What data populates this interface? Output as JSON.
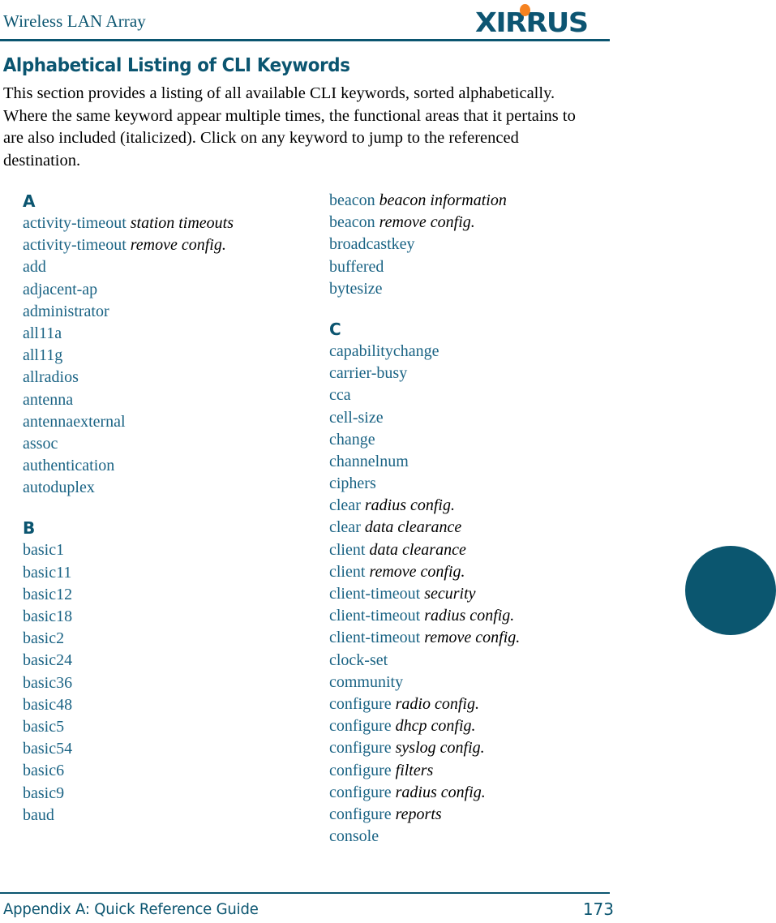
{
  "header": {
    "title": "Wireless LAN Array",
    "logo_text": "XIRRUS",
    "logo_color": "#0d5572",
    "logo_dot_color": "#f58220",
    "rule_color": "#0b5570"
  },
  "section": {
    "heading": "Alphabetical Listing of CLI Keywords",
    "intro": "This section provides a listing of all available CLI keywords, sorted alphabetically. Where the same keyword appear multiple times, the functional areas that it pertains to are also included (italicized). Click on any keyword to jump to the referenced destination."
  },
  "index": {
    "left_column": [
      {
        "type": "letter",
        "label": "A"
      },
      {
        "type": "keyword",
        "keyword": "activity-timeout",
        "area": "station timeouts"
      },
      {
        "type": "keyword",
        "keyword": "activity-timeout",
        "area": "remove config."
      },
      {
        "type": "keyword",
        "keyword": "add",
        "area": ""
      },
      {
        "type": "keyword",
        "keyword": "adjacent-ap",
        "area": ""
      },
      {
        "type": "keyword",
        "keyword": "administrator",
        "area": ""
      },
      {
        "type": "keyword",
        "keyword": "all11a",
        "area": ""
      },
      {
        "type": "keyword",
        "keyword": "all11g",
        "area": ""
      },
      {
        "type": "keyword",
        "keyword": "allradios",
        "area": ""
      },
      {
        "type": "keyword",
        "keyword": "antenna",
        "area": ""
      },
      {
        "type": "keyword",
        "keyword": "antennaexternal",
        "area": ""
      },
      {
        "type": "keyword",
        "keyword": "assoc",
        "area": ""
      },
      {
        "type": "keyword",
        "keyword": "authentication",
        "area": ""
      },
      {
        "type": "keyword",
        "keyword": "autoduplex",
        "area": ""
      },
      {
        "type": "letter",
        "label": "B",
        "spaced": true
      },
      {
        "type": "keyword",
        "keyword": "basic1",
        "area": ""
      },
      {
        "type": "keyword",
        "keyword": "basic11",
        "area": ""
      },
      {
        "type": "keyword",
        "keyword": "basic12",
        "area": ""
      },
      {
        "type": "keyword",
        "keyword": "basic18",
        "area": ""
      },
      {
        "type": "keyword",
        "keyword": "basic2",
        "area": ""
      },
      {
        "type": "keyword",
        "keyword": "basic24",
        "area": ""
      },
      {
        "type": "keyword",
        "keyword": "basic36",
        "area": ""
      },
      {
        "type": "keyword",
        "keyword": "basic48",
        "area": ""
      },
      {
        "type": "keyword",
        "keyword": "basic5",
        "area": ""
      },
      {
        "type": "keyword",
        "keyword": "basic54",
        "area": ""
      },
      {
        "type": "keyword",
        "keyword": "basic6",
        "area": ""
      },
      {
        "type": "keyword",
        "keyword": "basic9",
        "area": ""
      },
      {
        "type": "keyword",
        "keyword": "baud",
        "area": ""
      }
    ],
    "right_column": [
      {
        "type": "keyword",
        "keyword": "beacon",
        "area": "beacon information"
      },
      {
        "type": "keyword",
        "keyword": "beacon",
        "area": "remove config."
      },
      {
        "type": "keyword",
        "keyword": "broadcastkey",
        "area": ""
      },
      {
        "type": "keyword",
        "keyword": "buffered",
        "area": ""
      },
      {
        "type": "keyword",
        "keyword": "bytesize",
        "area": ""
      },
      {
        "type": "letter",
        "label": "C",
        "spaced": true
      },
      {
        "type": "keyword",
        "keyword": "capabilitychange",
        "area": ""
      },
      {
        "type": "keyword",
        "keyword": "carrier-busy",
        "area": ""
      },
      {
        "type": "keyword",
        "keyword": "cca",
        "area": ""
      },
      {
        "type": "keyword",
        "keyword": "cell-size",
        "area": ""
      },
      {
        "type": "keyword",
        "keyword": "change",
        "area": ""
      },
      {
        "type": "keyword",
        "keyword": "channelnum",
        "area": ""
      },
      {
        "type": "keyword",
        "keyword": "ciphers",
        "area": ""
      },
      {
        "type": "keyword",
        "keyword": "clear",
        "area": "radius config."
      },
      {
        "type": "keyword",
        "keyword": "clear",
        "area": "data clearance"
      },
      {
        "type": "keyword",
        "keyword": "client",
        "area": "data clearance"
      },
      {
        "type": "keyword",
        "keyword": "client",
        "area": "remove config."
      },
      {
        "type": "keyword",
        "keyword": "client-timeout",
        "area": "security"
      },
      {
        "type": "keyword",
        "keyword": "client-timeout",
        "area": "radius config."
      },
      {
        "type": "keyword",
        "keyword": "client-timeout",
        "area": "remove config."
      },
      {
        "type": "keyword",
        "keyword": "clock-set",
        "area": ""
      },
      {
        "type": "keyword",
        "keyword": "community",
        "area": ""
      },
      {
        "type": "keyword",
        "keyword": "configure",
        "area": "radio config."
      },
      {
        "type": "keyword",
        "keyword": "configure",
        "area": "dhcp config."
      },
      {
        "type": "keyword",
        "keyword": "configure",
        "area": "syslog config."
      },
      {
        "type": "keyword",
        "keyword": "configure",
        "area": "filters"
      },
      {
        "type": "keyword",
        "keyword": "configure",
        "area": "radius config."
      },
      {
        "type": "keyword",
        "keyword": "configure",
        "area": "reports"
      },
      {
        "type": "keyword",
        "keyword": "console",
        "area": ""
      }
    ]
  },
  "thumb_tab": {
    "color": "#0b566f"
  },
  "footer": {
    "text": "Appendix A: Quick Reference Guide",
    "page_number": "173"
  }
}
